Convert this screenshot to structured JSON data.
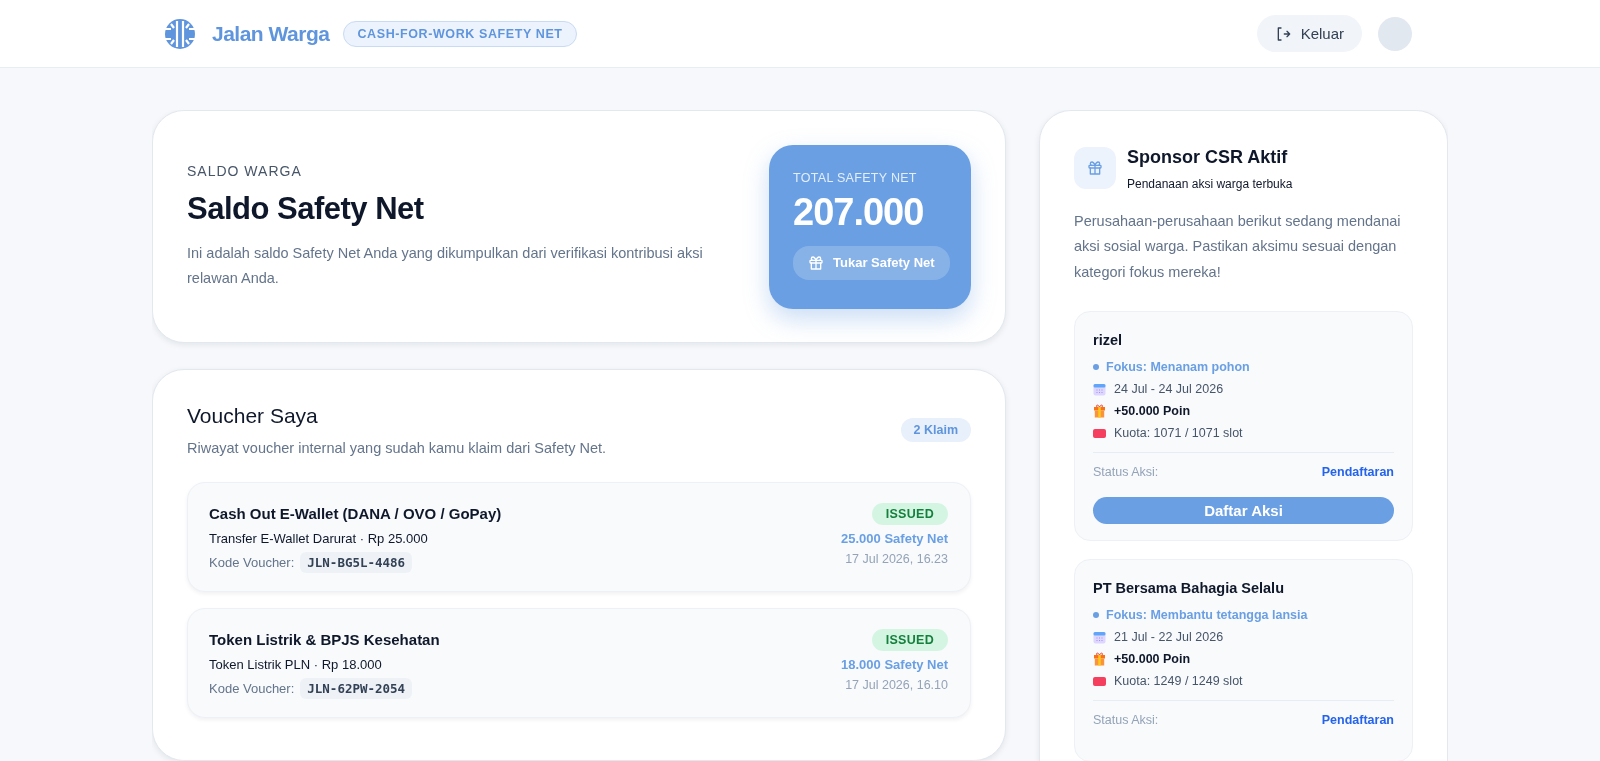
{
  "header": {
    "brand": "Jalan Warga",
    "tagline": "CASH-FOR-WORK SAFETY NET",
    "logout": "Keluar"
  },
  "balance": {
    "eyebrow": "SALDO WARGA",
    "title": "Saldo Safety Net",
    "description": "Ini adalah saldo Safety Net Anda yang dikumpulkan dari verifikasi kontribusi aksi relawan Anda.",
    "total_label": "TOTAL SAFETY NET",
    "total": "207.000",
    "redeem_button": "Tukar Safety Net"
  },
  "vouchers": {
    "title": "Voucher Saya",
    "subtitle": "Riwayat voucher internal yang sudah kamu klaim dari Safety Net.",
    "count": "2 Klaim",
    "items": [
      {
        "name": "Cash Out E-Wallet (DANA / OVO / GoPay)",
        "detail": "Transfer E-Wallet Darurat · Rp 25.000",
        "code_label": "Kode Voucher:",
        "code": "JLN-BG5L-4486",
        "status": "ISSUED",
        "cost": "25.000 Safety Net",
        "date": "17 Jul 2026, 16.23"
      },
      {
        "name": "Token Listrik & BPJS Kesehatan",
        "detail": "Token Listrik PLN · Rp 18.000",
        "code_label": "Kode Voucher:",
        "code": "JLN-62PW-2054",
        "status": "ISSUED",
        "cost": "18.000 Safety Net",
        "date": "17 Jul 2026, 16.10"
      }
    ]
  },
  "sponsors": {
    "title": "Sponsor CSR Aktif",
    "subtitle": "Pendanaan aksi warga terbuka",
    "description": "Perusahaan-perusahaan berikut sedang mendanai aksi sosial warga. Pastikan aksimu sesuai dengan kategori fokus mereka!",
    "items": [
      {
        "name": "rizel",
        "focus": "Fokus: Menanam pohon",
        "dates": "24 Jul - 24 Jul 2026",
        "reward": "+50.000 Poin",
        "quota": "Kuota: 1071 / 1071 slot",
        "status_label": "Status Aksi:",
        "status": "Pendaftaran",
        "button": "Daftar Aksi"
      },
      {
        "name": "PT Bersama Bahagia Selalu",
        "focus": "Fokus: Membantu tetangga lansia",
        "dates": "21 Jul - 22 Jul 2026",
        "reward": "+50.000 Poin",
        "quota": "Kuota: 1249 / 1249 slot",
        "status_label": "Status Aksi:",
        "status": "Pendaftaran"
      }
    ]
  }
}
